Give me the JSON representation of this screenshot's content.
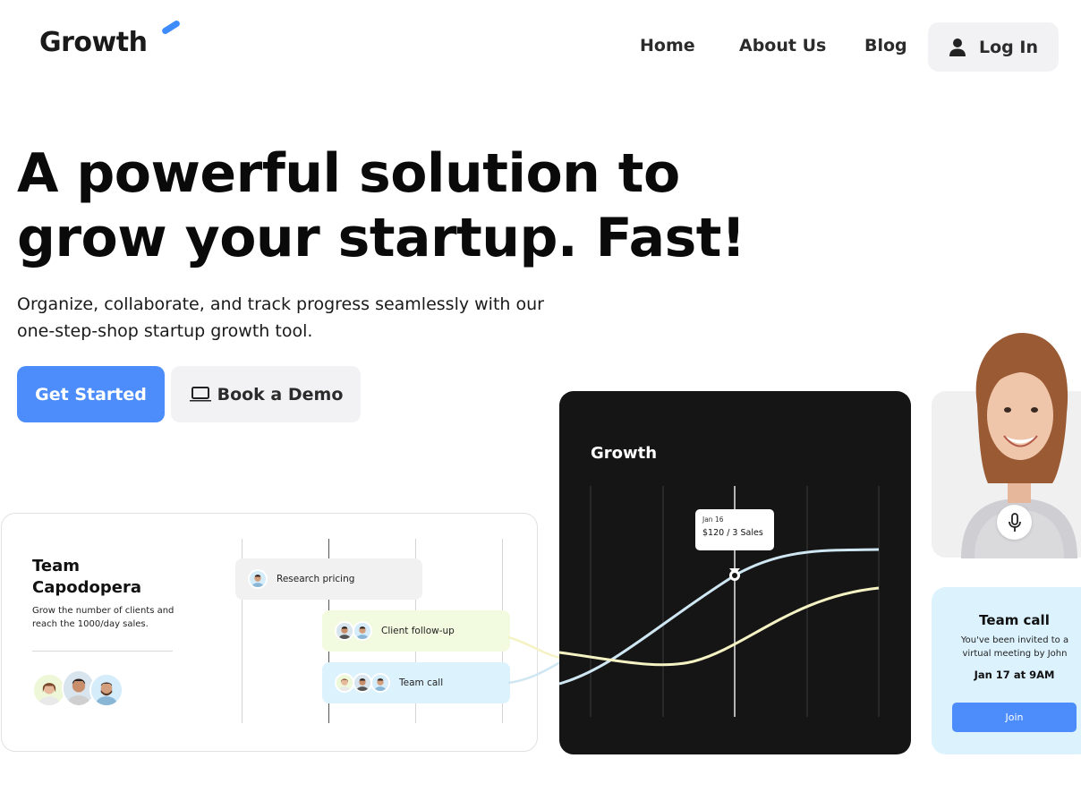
{
  "header": {
    "logo": "Growth",
    "nav": [
      "Home",
      "About Us",
      "Blog"
    ],
    "login_label": "Log In"
  },
  "hero": {
    "headline": "A powerful solution to grow your startup. Fast!",
    "subtext": "Organize, collaborate, and track progress seamlessly with our one-step-shop startup growth tool.",
    "primary_cta": "Get Started",
    "secondary_cta": "Book a Demo"
  },
  "team_card": {
    "title": "Team Capodopera",
    "description": "Grow the number of clients and reach the 1000/day sales.",
    "tasks": [
      {
        "label": "Research pricing",
        "color": "#f1f1f1"
      },
      {
        "label": "Client follow-up",
        "color": "#f2fadf"
      },
      {
        "label": "Team call",
        "color": "#dcf2fd"
      }
    ]
  },
  "growth_card": {
    "title": "Growth",
    "tooltip_date": "Jan 16",
    "tooltip_value": "$120 / 3 Sales"
  },
  "call_card": {
    "title": "Team call",
    "description": "You've been invited to a virtual meeting by John",
    "time": "Jan 17 at 9AM",
    "join_label": "Join"
  },
  "colors": {
    "accent": "#4c8dfb",
    "dark_card": "#151515",
    "call_bg": "#dcf2fd",
    "curve_blue": "#cfe6f3",
    "curve_yellow": "#f5f3c4"
  },
  "icons": [
    "user-icon",
    "laptop-icon",
    "mic-icon"
  ]
}
